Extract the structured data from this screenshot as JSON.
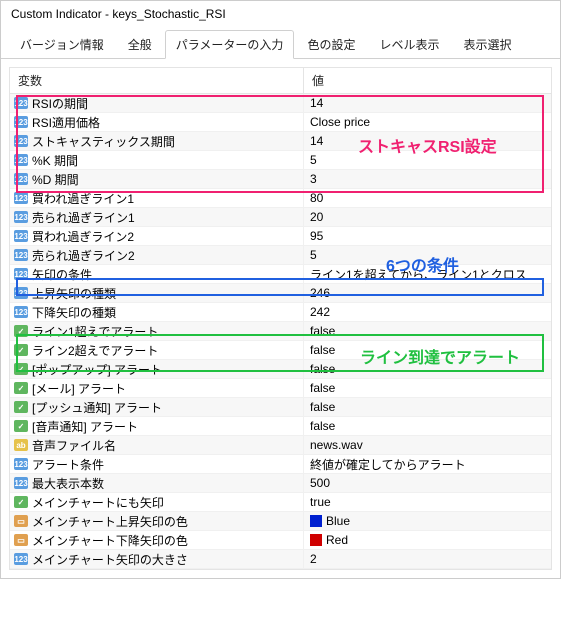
{
  "window": {
    "title": "Custom Indicator - keys_Stochastic_RSI"
  },
  "tabs": [
    {
      "label": "バージョン情報"
    },
    {
      "label": "全般"
    },
    {
      "label": "パラメーターの入力",
      "active": true
    },
    {
      "label": "色の設定"
    },
    {
      "label": "レベル表示"
    },
    {
      "label": "表示選択"
    }
  ],
  "columns": {
    "name": "変数",
    "value": "値"
  },
  "rows": [
    {
      "icon": "123",
      "name": "RSIの期間",
      "value": "14"
    },
    {
      "icon": "123",
      "name": "RSI適用価格",
      "value": "Close price"
    },
    {
      "icon": "123",
      "name": "ストキャスティックス期間",
      "value": "14"
    },
    {
      "icon": "123",
      "name": "%K 期間",
      "value": "5"
    },
    {
      "icon": "123",
      "name": "%D 期間",
      "value": "3"
    },
    {
      "icon": "123",
      "name": "買われ過ぎライン1",
      "value": "80"
    },
    {
      "icon": "123",
      "name": "売られ過ぎライン1",
      "value": "20"
    },
    {
      "icon": "123",
      "name": "買われ過ぎライン2",
      "value": "95"
    },
    {
      "icon": "123",
      "name": "売られ過ぎライン2",
      "value": "5"
    },
    {
      "icon": "123",
      "name": "矢印の条件",
      "value": "ライン1を超えてから、ライン1とクロス"
    },
    {
      "icon": "123",
      "name": "上昇矢印の種類",
      "value": "246"
    },
    {
      "icon": "123",
      "name": "下降矢印の種類",
      "value": "242"
    },
    {
      "icon": "bool",
      "name": "ライン1超えでアラート",
      "value": "false"
    },
    {
      "icon": "bool",
      "name": "ライン2超えでアラート",
      "value": "false"
    },
    {
      "icon": "bool",
      "name": "[ポップアップ] アラート",
      "value": "false"
    },
    {
      "icon": "bool",
      "name": "[メール] アラート",
      "value": "false"
    },
    {
      "icon": "bool",
      "name": "[プッシュ通知] アラート",
      "value": "false"
    },
    {
      "icon": "bool",
      "name": "[音声通知] アラート",
      "value": "false"
    },
    {
      "icon": "ab",
      "name": "音声ファイル名",
      "value": "news.wav"
    },
    {
      "icon": "123",
      "name": "アラート条件",
      "value": "終値が確定してからアラート"
    },
    {
      "icon": "123",
      "name": "最大表示本数",
      "value": "500"
    },
    {
      "icon": "bool",
      "name": "メインチャートにも矢印",
      "value": "true"
    },
    {
      "icon": "col",
      "name": "メインチャート上昇矢印の色",
      "value": "Blue",
      "swatch": "blue"
    },
    {
      "icon": "col",
      "name": "メインチャート下降矢印の色",
      "value": "Red",
      "swatch": "red"
    },
    {
      "icon": "123",
      "name": "メインチャート矢印の大きさ",
      "value": "2"
    }
  ],
  "overlays": {
    "pink_label": "ストキャスRSI設定",
    "blue_label": "6つの条件",
    "green_label": "ライン到達でアラート"
  }
}
